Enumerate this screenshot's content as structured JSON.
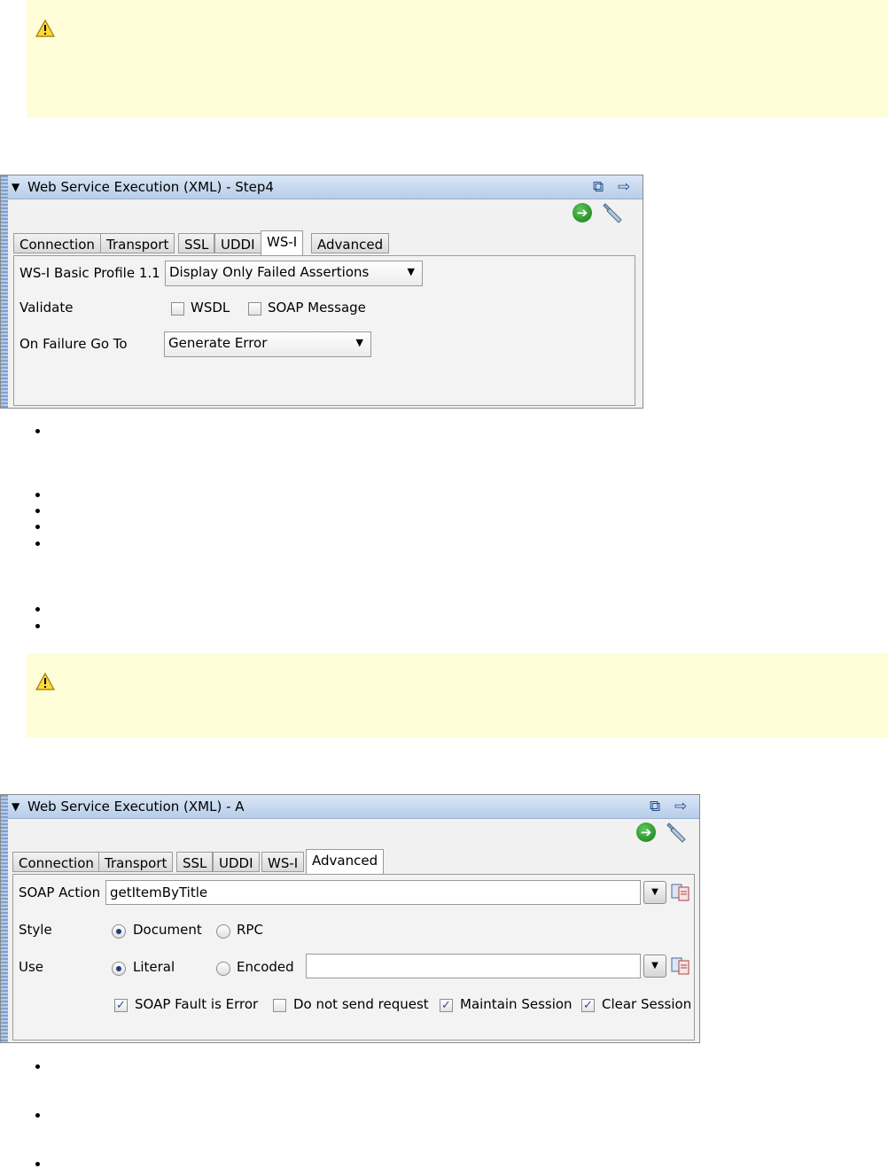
{
  "panel1": {
    "title": "Web Service Execution (XML) - Step4",
    "tabs": [
      "Connection",
      "Transport",
      "SSL",
      "UDDI",
      "WS-I",
      "Advanced"
    ],
    "active_tab": "WS-I",
    "profile_label": "WS-I Basic Profile 1.1",
    "profile_value": "Display Only Failed Assertions",
    "validate_label": "Validate",
    "wsdl_label": "WSDL",
    "soap_message_label": "SOAP Message",
    "wsdl_checked": false,
    "soap_message_checked": false,
    "on_failure_label": "On Failure Go To",
    "on_failure_value": "Generate Error"
  },
  "panel2": {
    "title": "Web Service Execution (XML) - A",
    "tabs": [
      "Connection",
      "Transport",
      "SSL",
      "UDDI",
      "WS-I",
      "Advanced"
    ],
    "active_tab": "Advanced",
    "soap_action_label": "SOAP Action",
    "soap_action_value": "getItemByTitle",
    "style_label": "Style",
    "style_options": [
      "Document",
      "RPC"
    ],
    "style_selected": "Document",
    "use_label": "Use",
    "use_options": [
      "Literal",
      "Encoded"
    ],
    "use_selected": "Literal",
    "encoded_value": "",
    "checkboxes": [
      {
        "label": "SOAP Fault is Error",
        "checked": true
      },
      {
        "label": "Do not send request",
        "checked": false
      },
      {
        "label": "Maintain Session",
        "checked": true
      },
      {
        "label": "Clear Session",
        "checked": true
      }
    ]
  },
  "colors": {
    "note_bg": "#fffdd8",
    "titlebar": "#b8cde9",
    "go_green": "#2e9b2e"
  },
  "icons": [
    "warning-icon",
    "float-icon",
    "dock-arrow-icon",
    "go-icon",
    "wrench-icon",
    "copy-icon",
    "chevron-down-icon"
  ]
}
